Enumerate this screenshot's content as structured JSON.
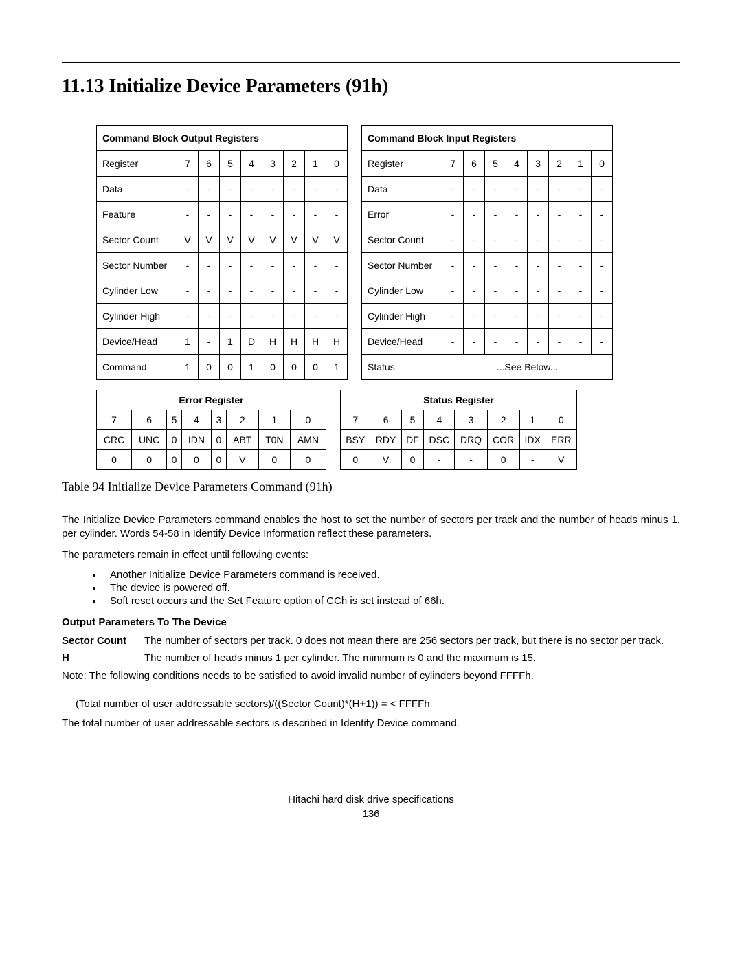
{
  "heading": "11.13   Initialize Device Parameters (91h)",
  "outputRegisters": {
    "title": "Command Block Output Registers",
    "colLabel": "Register",
    "bits": [
      "7",
      "6",
      "5",
      "4",
      "3",
      "2",
      "1",
      "0"
    ],
    "rows": [
      {
        "label": "Data",
        "cells": [
          "-",
          "-",
          "-",
          "-",
          "-",
          "-",
          "-",
          "-"
        ]
      },
      {
        "label": "Feature",
        "cells": [
          "-",
          "-",
          "-",
          "-",
          "-",
          "-",
          "-",
          "-"
        ]
      },
      {
        "label": "Sector Count",
        "cells": [
          "V",
          "V",
          "V",
          "V",
          "V",
          "V",
          "V",
          "V"
        ]
      },
      {
        "label": "Sector Number",
        "cells": [
          "-",
          "-",
          "-",
          "-",
          "-",
          "-",
          "-",
          "-"
        ]
      },
      {
        "label": "Cylinder Low",
        "cells": [
          "-",
          "-",
          "-",
          "-",
          "-",
          "-",
          "-",
          "-"
        ]
      },
      {
        "label": "Cylinder High",
        "cells": [
          "-",
          "-",
          "-",
          "-",
          "-",
          "-",
          "-",
          "-"
        ]
      },
      {
        "label": "Device/Head",
        "cells": [
          "1",
          "-",
          "1",
          "D",
          "H",
          "H",
          "H",
          "H"
        ]
      },
      {
        "label": "Command",
        "cells": [
          "1",
          "0",
          "0",
          "1",
          "0",
          "0",
          "0",
          "1"
        ]
      }
    ]
  },
  "inputRegisters": {
    "title": "Command Block Input Registers",
    "colLabel": "Register",
    "bits": [
      "7",
      "6",
      "5",
      "4",
      "3",
      "2",
      "1",
      "0"
    ],
    "rows": [
      {
        "label": "Data",
        "cells": [
          "-",
          "-",
          "-",
          "-",
          "-",
          "-",
          "-",
          "-"
        ]
      },
      {
        "label": "Error",
        "cells": [
          "-",
          "-",
          "-",
          "-",
          "-",
          "-",
          "-",
          "-"
        ]
      },
      {
        "label": "Sector Count",
        "cells": [
          "-",
          "-",
          "-",
          "-",
          "-",
          "-",
          "-",
          "-"
        ]
      },
      {
        "label": "Sector Number",
        "cells": [
          "-",
          "-",
          "-",
          "-",
          "-",
          "-",
          "-",
          "-"
        ]
      },
      {
        "label": "Cylinder Low",
        "cells": [
          "-",
          "-",
          "-",
          "-",
          "-",
          "-",
          "-",
          "-"
        ]
      },
      {
        "label": "Cylinder High",
        "cells": [
          "-",
          "-",
          "-",
          "-",
          "-",
          "-",
          "-",
          "-"
        ]
      },
      {
        "label": "Device/Head",
        "cells": [
          "-",
          "-",
          "-",
          "-",
          "-",
          "-",
          "-",
          "-"
        ]
      }
    ],
    "statusLabel": "Status",
    "statusText": "...See Below..."
  },
  "errorRegister": {
    "title": "Error Register",
    "bits": [
      "7",
      "6",
      "5",
      "4",
      "3",
      "2",
      "1",
      "0"
    ],
    "names": [
      "CRC",
      "UNC",
      "0",
      "IDN",
      "0",
      "ABT",
      "T0N",
      "AMN"
    ],
    "values": [
      "0",
      "0",
      "0",
      "0",
      "0",
      "V",
      "0",
      "0"
    ]
  },
  "statusRegister": {
    "title": "Status Register",
    "bits": [
      "7",
      "6",
      "5",
      "4",
      "3",
      "2",
      "1",
      "0"
    ],
    "names": [
      "BSY",
      "RDY",
      "DF",
      "DSC",
      "DRQ",
      "COR",
      "IDX",
      "ERR"
    ],
    "values": [
      "0",
      "V",
      "0",
      "-",
      "-",
      "0",
      "-",
      "V"
    ]
  },
  "tableCaption": "Table 94    Initialize Device Parameters Command (91h)",
  "para1": "The Initialize Device Parameters command enables the host to set the number of sectors per track and the number of heads minus 1, per cylinder. Words 54-58 in Identify Device Information reflect these parameters.",
  "para2": "The parameters remain in effect until following events:",
  "bullets": [
    "Another Initialize Device Parameters command is received.",
    "The device is powered off.",
    "Soft reset occurs and the Set Feature option of CCh is set instead of 66h."
  ],
  "outputParamsHead": "Output Parameters To The Device",
  "paramSectorCount": {
    "label": "Sector Count",
    "text": "The number of sectors per track. 0 does not mean there are 256 sectors per track, but there is no sector per track."
  },
  "paramH": {
    "label": "H",
    "text": "The number of heads minus 1 per cylinder. The minimum is 0 and the maximum is 15."
  },
  "note": "Note: The following conditions needs to be satisfied to avoid invalid number of cylinders beyond FFFFh.",
  "formula": "(Total number of user addressable sectors)/((Sector Count)*(H+1)) = < FFFFh",
  "closing": "The total number of user addressable sectors is described in Identify Device command.",
  "footer1": "Hitachi hard disk drive specifications",
  "footer2": "136"
}
